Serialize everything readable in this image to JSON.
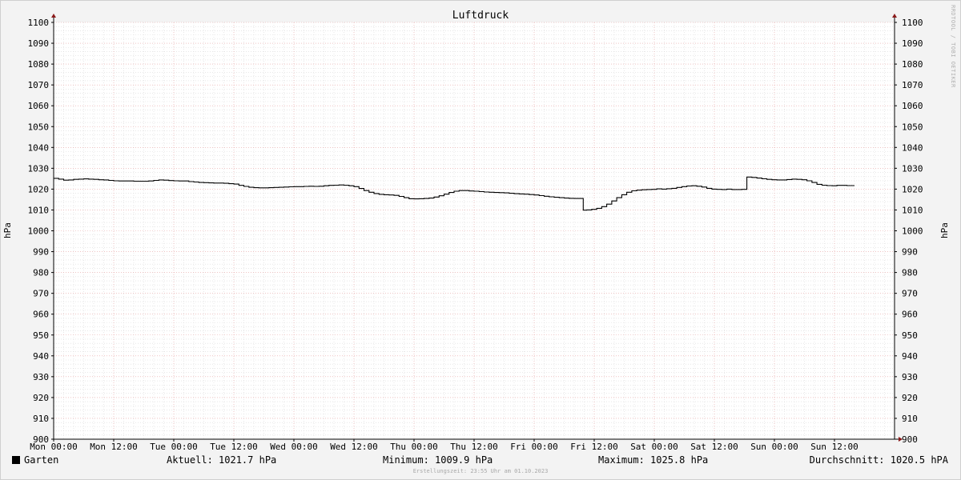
{
  "chart_data": {
    "type": "line",
    "title": "Luftdruck",
    "ylabel_left": "hPa",
    "ylabel_right": "hPa",
    "ylim": [
      900,
      1100
    ],
    "y_ticks": [
      900,
      910,
      920,
      930,
      940,
      950,
      960,
      970,
      980,
      990,
      1000,
      1010,
      1020,
      1030,
      1040,
      1050,
      1060,
      1070,
      1080,
      1090,
      1100
    ],
    "x_range_hours": [
      0,
      168
    ],
    "x_ticks": [
      {
        "h": 0,
        "label": "Mon 00:00"
      },
      {
        "h": 12,
        "label": "Mon 12:00"
      },
      {
        "h": 24,
        "label": "Tue 00:00"
      },
      {
        "h": 36,
        "label": "Tue 12:00"
      },
      {
        "h": 48,
        "label": "Wed 00:00"
      },
      {
        "h": 60,
        "label": "Wed 12:00"
      },
      {
        "h": 72,
        "label": "Thu 00:00"
      },
      {
        "h": 84,
        "label": "Thu 12:00"
      },
      {
        "h": 96,
        "label": "Fri 00:00"
      },
      {
        "h": 108,
        "label": "Fri 12:00"
      },
      {
        "h": 120,
        "label": "Sat 00:00"
      },
      {
        "h": 132,
        "label": "Sat 12:00"
      },
      {
        "h": 144,
        "label": "Sun 00:00"
      },
      {
        "h": 156,
        "label": "Sun 12:00"
      }
    ],
    "grid": true,
    "series": [
      {
        "name": "Garten",
        "color": "#000000",
        "points": [
          [
            0,
            1025.2
          ],
          [
            1,
            1024.8
          ],
          [
            2,
            1024.3
          ],
          [
            3,
            1024.4
          ],
          [
            4,
            1024.7
          ],
          [
            5,
            1024.8
          ],
          [
            6,
            1024.9
          ],
          [
            7,
            1024.8
          ],
          [
            8,
            1024.7
          ],
          [
            9,
            1024.5
          ],
          [
            10,
            1024.4
          ],
          [
            11,
            1024.2
          ],
          [
            12,
            1024.0
          ],
          [
            13,
            1023.9
          ],
          [
            14,
            1023.9
          ],
          [
            15,
            1023.9
          ],
          [
            16,
            1023.8
          ],
          [
            17,
            1023.8
          ],
          [
            18,
            1023.8
          ],
          [
            19,
            1023.9
          ],
          [
            20,
            1024.2
          ],
          [
            21,
            1024.4
          ],
          [
            22,
            1024.3
          ],
          [
            23,
            1024.1
          ],
          [
            24,
            1024.0
          ],
          [
            25,
            1023.9
          ],
          [
            26,
            1023.9
          ],
          [
            27,
            1023.6
          ],
          [
            28,
            1023.4
          ],
          [
            29,
            1023.2
          ],
          [
            30,
            1023.1
          ],
          [
            31,
            1023.0
          ],
          [
            32,
            1022.9
          ],
          [
            33,
            1022.9
          ],
          [
            34,
            1022.8
          ],
          [
            35,
            1022.6
          ],
          [
            36,
            1022.4
          ],
          [
            37,
            1021.8
          ],
          [
            38,
            1021.3
          ],
          [
            39,
            1020.9
          ],
          [
            40,
            1020.7
          ],
          [
            41,
            1020.6
          ],
          [
            42,
            1020.6
          ],
          [
            43,
            1020.7
          ],
          [
            44,
            1020.8
          ],
          [
            45,
            1020.9
          ],
          [
            46,
            1021.0
          ],
          [
            47,
            1021.1
          ],
          [
            48,
            1021.2
          ],
          [
            49,
            1021.2
          ],
          [
            50,
            1021.3
          ],
          [
            51,
            1021.4
          ],
          [
            52,
            1021.3
          ],
          [
            53,
            1021.4
          ],
          [
            54,
            1021.6
          ],
          [
            55,
            1021.8
          ],
          [
            56,
            1021.9
          ],
          [
            57,
            1022.0
          ],
          [
            58,
            1021.9
          ],
          [
            59,
            1021.6
          ],
          [
            60,
            1021.2
          ],
          [
            61,
            1020.3
          ],
          [
            62,
            1019.3
          ],
          [
            63,
            1018.5
          ],
          [
            64,
            1017.9
          ],
          [
            65,
            1017.5
          ],
          [
            66,
            1017.3
          ],
          [
            67,
            1017.2
          ],
          [
            68,
            1017.0
          ],
          [
            69,
            1016.5
          ],
          [
            70,
            1015.9
          ],
          [
            71,
            1015.4
          ],
          [
            72,
            1015.3
          ],
          [
            73,
            1015.4
          ],
          [
            74,
            1015.5
          ],
          [
            75,
            1015.7
          ],
          [
            76,
            1016.2
          ],
          [
            77,
            1016.8
          ],
          [
            78,
            1017.6
          ],
          [
            79,
            1018.4
          ],
          [
            80,
            1019.0
          ],
          [
            81,
            1019.3
          ],
          [
            82,
            1019.3
          ],
          [
            83,
            1019.1
          ],
          [
            84,
            1019.0
          ],
          [
            85,
            1018.8
          ],
          [
            86,
            1018.6
          ],
          [
            87,
            1018.5
          ],
          [
            88,
            1018.4
          ],
          [
            89,
            1018.3
          ],
          [
            90,
            1018.2
          ],
          [
            91,
            1018.0
          ],
          [
            92,
            1017.8
          ],
          [
            93,
            1017.7
          ],
          [
            94,
            1017.6
          ],
          [
            95,
            1017.4
          ],
          [
            96,
            1017.2
          ],
          [
            97,
            1016.9
          ],
          [
            98,
            1016.6
          ],
          [
            99,
            1016.3
          ],
          [
            100,
            1016.1
          ],
          [
            101,
            1015.9
          ],
          [
            102,
            1015.7
          ],
          [
            103,
            1015.6
          ],
          [
            104,
            1015.5
          ],
          [
            105,
            1015.5
          ],
          [
            105.6,
            1015.5
          ],
          [
            105.8,
            1009.9
          ],
          [
            106.5,
            1010.0
          ],
          [
            107.5,
            1010.3
          ],
          [
            108.5,
            1010.8
          ],
          [
            109.5,
            1011.6
          ],
          [
            110.5,
            1012.8
          ],
          [
            111.5,
            1014.3
          ],
          [
            112.5,
            1015.9
          ],
          [
            113.5,
            1017.3
          ],
          [
            114.5,
            1018.5
          ],
          [
            115.5,
            1019.2
          ],
          [
            116.5,
            1019.5
          ],
          [
            117.5,
            1019.7
          ],
          [
            118.5,
            1019.8
          ],
          [
            119.5,
            1019.9
          ],
          [
            120.5,
            1020.1
          ],
          [
            121.5,
            1020.0
          ],
          [
            122.5,
            1020.2
          ],
          [
            123.5,
            1020.4
          ],
          [
            124.5,
            1020.8
          ],
          [
            125.5,
            1021.2
          ],
          [
            126.5,
            1021.5
          ],
          [
            127.5,
            1021.6
          ],
          [
            128.5,
            1021.4
          ],
          [
            129.5,
            1021.0
          ],
          [
            130.5,
            1020.4
          ],
          [
            131.5,
            1020.0
          ],
          [
            132.5,
            1019.9
          ],
          [
            133.5,
            1019.8
          ],
          [
            134.5,
            1020.0
          ],
          [
            135.5,
            1019.8
          ],
          [
            136.5,
            1019.8
          ],
          [
            137.5,
            1019.9
          ],
          [
            138.3,
            1019.9
          ],
          [
            138.5,
            1025.8
          ],
          [
            139.5,
            1025.6
          ],
          [
            140.5,
            1025.3
          ],
          [
            141.5,
            1025.0
          ],
          [
            142.5,
            1024.7
          ],
          [
            143.5,
            1024.5
          ],
          [
            144.5,
            1024.4
          ],
          [
            145.5,
            1024.4
          ],
          [
            146.5,
            1024.6
          ],
          [
            147.5,
            1024.8
          ],
          [
            148.5,
            1024.7
          ],
          [
            149.5,
            1024.5
          ],
          [
            150.5,
            1024.0
          ],
          [
            151.5,
            1023.2
          ],
          [
            152.5,
            1022.3
          ],
          [
            153.5,
            1021.9
          ],
          [
            154.5,
            1021.7
          ],
          [
            155.5,
            1021.6
          ],
          [
            156.5,
            1021.8
          ],
          [
            157.5,
            1021.8
          ],
          [
            158.5,
            1021.7
          ],
          [
            159.5,
            1021.7
          ],
          [
            160,
            1021.7
          ]
        ]
      }
    ]
  },
  "legend": {
    "series_label": "Garten",
    "current": "Aktuell: 1021.7 hPa",
    "minimum": "Minimum: 1009.9 hPa",
    "maximum": "Maximum: 1025.8 hPa",
    "average": "Durchschnitt: 1020.5 hPA"
  },
  "footer": "Erstellungszeit: 23:55 Uhr am 01.10.2023",
  "side_label": "RRDTOOL / TOBI OETIKER"
}
